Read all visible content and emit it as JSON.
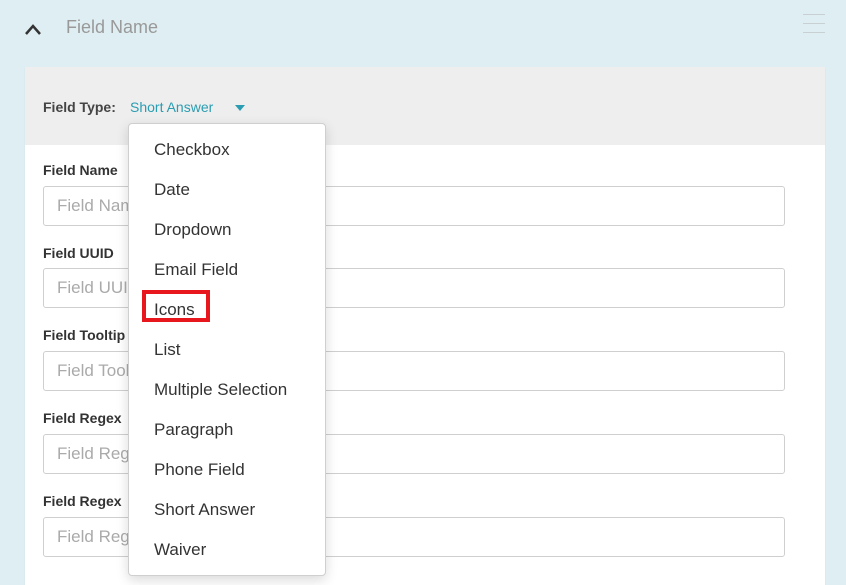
{
  "header": {
    "title": "Field Name"
  },
  "field_type": {
    "label": "Field Type:",
    "value": "Short Answer"
  },
  "fields": [
    {
      "label": "Field Name",
      "placeholder": "Field Name"
    },
    {
      "label": "Field UUID",
      "placeholder": "Field UUID"
    },
    {
      "label": "Field Tooltip",
      "placeholder": "Field Tooltip"
    },
    {
      "label": "Field Regex",
      "placeholder": "Field Regex"
    },
    {
      "label": "Field Regex",
      "placeholder": "Field Regex"
    }
  ],
  "dropdown": {
    "items": [
      "Checkbox",
      "Date",
      "Dropdown",
      "Email Field",
      "Icons",
      "List",
      "Multiple Selection",
      "Paragraph",
      "Phone Field",
      "Short Answer",
      "Waiver"
    ],
    "highlighted_item": "Icons",
    "highlight_color": "#e8161d"
  },
  "colors": {
    "accent": "#2a9db2",
    "background": "#dfeef2"
  },
  "icons": {
    "collapse": "chevron-up-icon",
    "menu": "hamburger-icon",
    "type_toggle": "caret-down-icon"
  }
}
